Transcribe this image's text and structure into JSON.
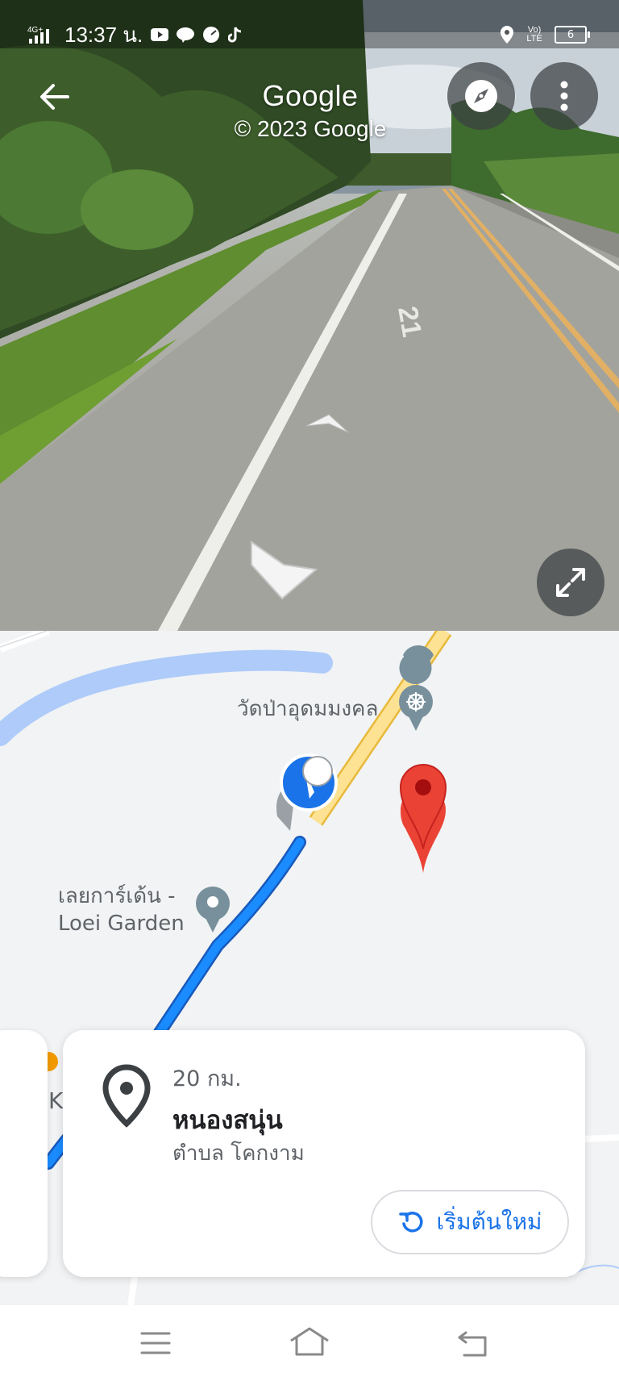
{
  "status_bar": {
    "network": "4G+",
    "time": "13:37 น.",
    "volte": "VoLTE",
    "battery": "6"
  },
  "header": {
    "title": "Google",
    "subtitle": "© 2023 Google"
  },
  "street_view": {
    "road_marking": "21"
  },
  "map": {
    "poi_temple": "วัดป่าอุดมมงคล",
    "poi_garden": "เลยการ์เด้น -\nLoei Garden",
    "partial_letter": "K",
    "colors": {
      "route": "#1a73e8",
      "highway": "#f6d365",
      "water": "#aecbfa",
      "pin": "#ea4335"
    }
  },
  "card": {
    "distance": "20 กม.",
    "place_name": "หนองสนุ่น",
    "subdistrict": "ตำบล โคกงาม",
    "restart_label": "เริ่มต้นใหม่"
  },
  "icons": [
    "back-arrow-icon",
    "compass-icon",
    "more-vert-icon",
    "expand-icon",
    "location-pin-icon",
    "restart-icon",
    "menu-icon",
    "home-icon",
    "back-nav-icon"
  ]
}
